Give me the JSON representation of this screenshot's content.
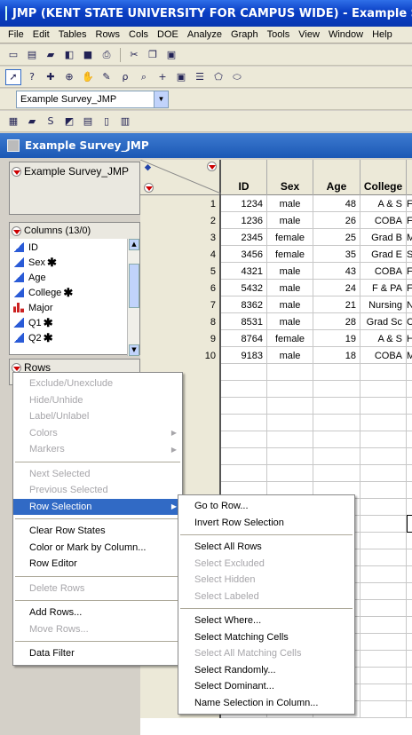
{
  "window": {
    "title": "JMP (KENT STATE UNIVERSITY FOR CAMPUS WIDE)  - Example Survey_JMP"
  },
  "menubar": [
    "File",
    "Edit",
    "Tables",
    "Rows",
    "Cols",
    "DOE",
    "Analyze",
    "Graph",
    "Tools",
    "View",
    "Window",
    "Help"
  ],
  "table_selector": {
    "value": "Example Survey_JMP"
  },
  "data_window": {
    "title": "Example Survey_JMP"
  },
  "table_panel": {
    "name": "Example Survey_JMP"
  },
  "columns_panel": {
    "header": "Columns (13/0)",
    "items": [
      {
        "name": "ID",
        "type": "continuous",
        "starred": false
      },
      {
        "name": "Sex",
        "type": "continuous",
        "starred": true
      },
      {
        "name": "Age",
        "type": "continuous",
        "starred": false
      },
      {
        "name": "College",
        "type": "continuous",
        "starred": true
      },
      {
        "name": "Major",
        "type": "nominal",
        "starred": false
      },
      {
        "name": "Q1",
        "type": "continuous",
        "starred": true
      },
      {
        "name": "Q2",
        "type": "continuous",
        "starred": true
      }
    ]
  },
  "rows_panel": {
    "header": "Rows"
  },
  "table": {
    "columns": [
      "ID",
      "Sex",
      "Age",
      "College",
      ""
    ],
    "rows": [
      {
        "n": "1",
        "id": "1234",
        "sex": "male",
        "age": "48",
        "college": "A & S",
        "extra": "F"
      },
      {
        "n": "2",
        "id": "1236",
        "sex": "male",
        "age": "26",
        "college": "COBA",
        "extra": "F"
      },
      {
        "n": "3",
        "id": "2345",
        "sex": "female",
        "age": "25",
        "college": "Grad B",
        "extra": "M"
      },
      {
        "n": "4",
        "id": "3456",
        "sex": "female",
        "age": "35",
        "college": "Grad E",
        "extra": "S"
      },
      {
        "n": "5",
        "id": "4321",
        "sex": "male",
        "age": "43",
        "college": "COBA",
        "extra": "F"
      },
      {
        "n": "6",
        "id": "5432",
        "sex": "male",
        "age": "24",
        "college": "F & PA",
        "extra": "F"
      },
      {
        "n": "7",
        "id": "8362",
        "sex": "male",
        "age": "21",
        "college": "Nursing",
        "extra": "N"
      },
      {
        "n": "8",
        "id": "8531",
        "sex": "male",
        "age": "28",
        "college": "Grad Sc",
        "extra": "C"
      },
      {
        "n": "9",
        "id": "8764",
        "sex": "female",
        "age": "19",
        "college": "A & S",
        "extra": "H"
      },
      {
        "n": "10",
        "id": "9183",
        "sex": "male",
        "age": "18",
        "college": "COBA",
        "extra": "M"
      }
    ]
  },
  "rows_menu": {
    "groups": [
      [
        {
          "label": "Exclude/Unexclude",
          "enabled": false
        },
        {
          "label": "Hide/Unhide",
          "enabled": false
        },
        {
          "label": "Label/Unlabel",
          "enabled": false
        },
        {
          "label": "Colors",
          "enabled": false,
          "submenu": true
        },
        {
          "label": "Markers",
          "enabled": false,
          "submenu": true
        }
      ],
      [
        {
          "label": "Next Selected",
          "enabled": false
        },
        {
          "label": "Previous Selected",
          "enabled": false
        },
        {
          "label": "Row Selection",
          "enabled": true,
          "submenu": true,
          "highlighted": true
        }
      ],
      [
        {
          "label": "Clear Row States",
          "enabled": true
        },
        {
          "label": "Color or Mark by Column...",
          "enabled": true
        },
        {
          "label": "Row Editor",
          "enabled": true
        }
      ],
      [
        {
          "label": "Delete Rows",
          "enabled": false
        }
      ],
      [
        {
          "label": "Add Rows...",
          "enabled": true
        },
        {
          "label": "Move Rows...",
          "enabled": false
        }
      ],
      [
        {
          "label": "Data Filter",
          "enabled": true
        }
      ]
    ]
  },
  "row_selection_submenu": {
    "groups": [
      [
        {
          "label": "Go to Row...",
          "enabled": true
        },
        {
          "label": "Invert Row Selection",
          "enabled": true
        }
      ],
      [
        {
          "label": "Select All Rows",
          "enabled": true
        },
        {
          "label": "Select Excluded",
          "enabled": false
        },
        {
          "label": "Select Hidden",
          "enabled": false
        },
        {
          "label": "Select Labeled",
          "enabled": false
        }
      ],
      [
        {
          "label": "Select Where...",
          "enabled": true
        },
        {
          "label": "Select Matching Cells",
          "enabled": true
        },
        {
          "label": "Select All Matching Cells",
          "enabled": false
        },
        {
          "label": "Select Randomly...",
          "enabled": true
        },
        {
          "label": "Select Dominant...",
          "enabled": true
        },
        {
          "label": "Name Selection in Column...",
          "enabled": true
        }
      ]
    ]
  },
  "colors": {
    "title_bar": "#0a3fc4",
    "menu_highlight": "#316ac5",
    "disabled_text": "#a7a6aa"
  }
}
